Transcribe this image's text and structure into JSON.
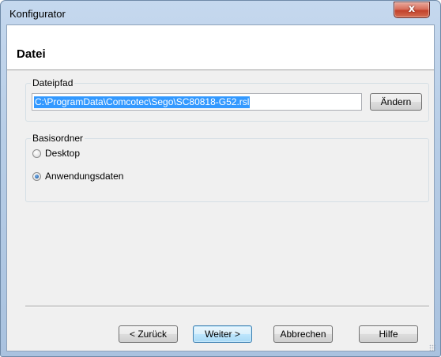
{
  "window": {
    "title": "Konfigurator",
    "close_glyph": "x"
  },
  "header": {
    "title": "Datei"
  },
  "file_group": {
    "label": "Dateipfad",
    "path_value": "C:\\ProgramData\\Comcotec\\Sego\\SC80818-G52.rsl",
    "change_button": "Ändern"
  },
  "base_group": {
    "label": "Basisordner",
    "options": [
      {
        "label": "Desktop",
        "selected": false
      },
      {
        "label": "Anwendungsdaten",
        "selected": true
      }
    ]
  },
  "footer": {
    "back_button": "< Zurück",
    "next_button": "Weiter >",
    "cancel_button": "Abbrechen",
    "help_button": "Hilfe"
  },
  "icons": {
    "close": "close-icon",
    "radio": "radio-icon",
    "resize_grip": "resize-grip-icon"
  },
  "colors": {
    "selection": "#3399ff",
    "close_button": "#c2422b",
    "default_button": "#3c7fb1"
  }
}
